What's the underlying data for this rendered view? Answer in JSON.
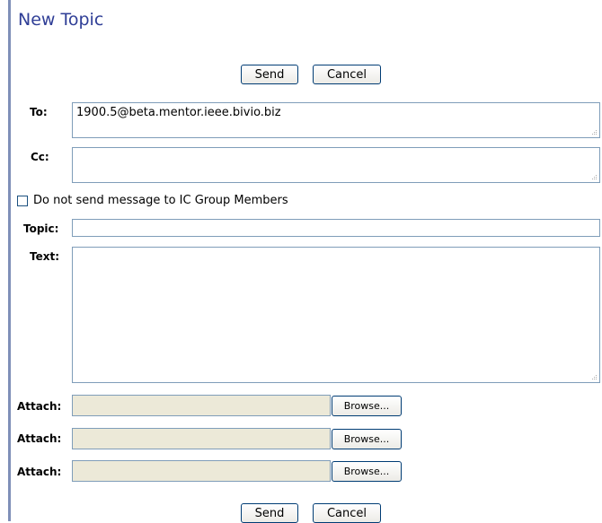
{
  "page": {
    "title": "New Topic"
  },
  "buttons": {
    "send": "Send",
    "cancel": "Cancel",
    "browse": "Browse..."
  },
  "form": {
    "to": {
      "label": "To:",
      "value": "1900.5@beta.mentor.ieee.bivio.biz"
    },
    "cc": {
      "label": "Cc:",
      "value": ""
    },
    "no_group": {
      "label": "Do not send message to IC Group Members",
      "checked": false
    },
    "topic": {
      "label": "Topic:",
      "value": ""
    },
    "text": {
      "label": "Text:",
      "value": ""
    },
    "attach": [
      {
        "label": "Attach:",
        "value": ""
      },
      {
        "label": "Attach:",
        "value": ""
      },
      {
        "label": "Attach:",
        "value": ""
      }
    ]
  }
}
